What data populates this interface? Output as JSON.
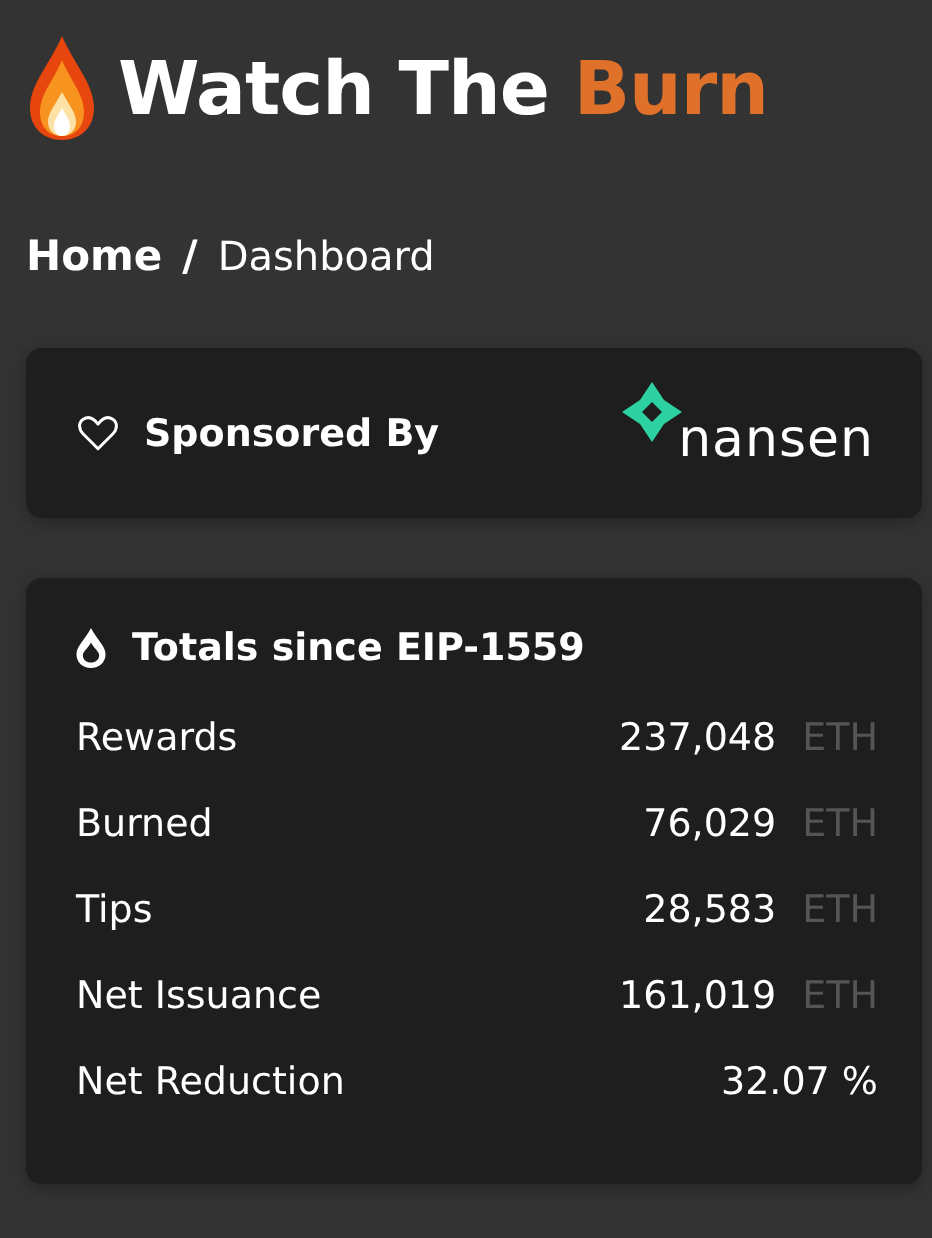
{
  "header": {
    "title": "Watch The",
    "title_accent": "Burn"
  },
  "breadcrumb": [
    {
      "label": "Home",
      "current": false
    },
    {
      "label": "Dashboard",
      "current": true
    }
  ],
  "breadcrumb_separator": "/",
  "sponsor_card": {
    "title": "Sponsored By",
    "sponsor": "nansen"
  },
  "totals_card": {
    "title": "Totals since EIP-1559",
    "rows": [
      {
        "label": "Rewards",
        "value": "237,048",
        "unit": "ETH"
      },
      {
        "label": "Burned",
        "value": "76,029",
        "unit": "ETH"
      },
      {
        "label": "Tips",
        "value": "28,583",
        "unit": "ETH"
      },
      {
        "label": "Net Issuance",
        "value": "161,019",
        "unit": "ETH"
      },
      {
        "label": "Net Reduction",
        "value": "32.07 %"
      }
    ]
  }
}
